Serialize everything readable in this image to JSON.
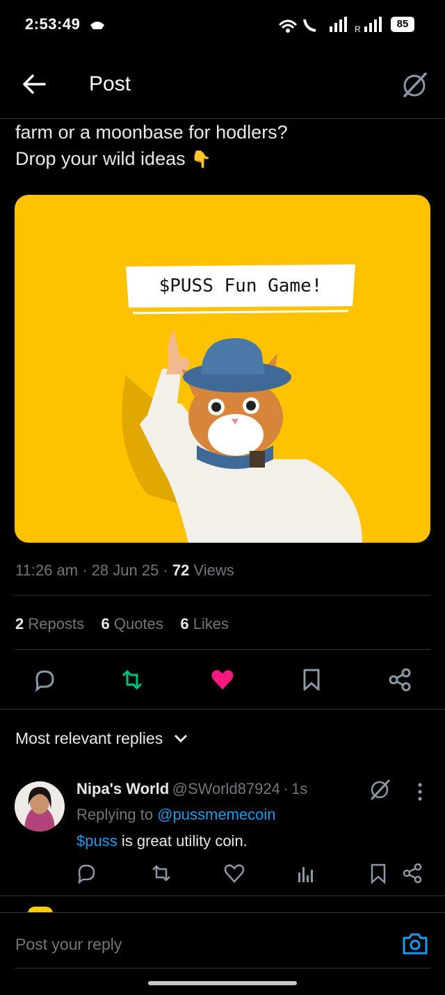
{
  "status": {
    "time": "2:53:49",
    "battery": "85"
  },
  "header": {
    "title": "Post"
  },
  "post": {
    "line1": "farm or a moonbase for hodlers?",
    "line2": "Drop your wild ideas",
    "line2_emoji": "👇",
    "image_banner": "$PUSS Fun Game!",
    "time": "11:26 am",
    "date": "28 Jun 25",
    "views_count": "72",
    "views_label": "Views",
    "reposts_count": "2",
    "reposts_label": "Reposts",
    "quotes_count": "6",
    "quotes_label": "Quotes",
    "likes_count": "6",
    "likes_label": "Likes"
  },
  "replies_sort": {
    "label": "Most relevant replies"
  },
  "reply": {
    "name": "Nipa's World",
    "handle": "@SWorld87924",
    "time": "1s",
    "replying_prefix": "Replying to",
    "replying_handle": "@pussmemecoin",
    "text_link": "$puss",
    "text_rest": " is great utility coin."
  },
  "composer": {
    "placeholder": "Post your reply"
  },
  "colors": {
    "accent": "#1d9bf0",
    "like": "#f91880",
    "repost": "#00ba7c",
    "image_bg": "#ffc200"
  }
}
